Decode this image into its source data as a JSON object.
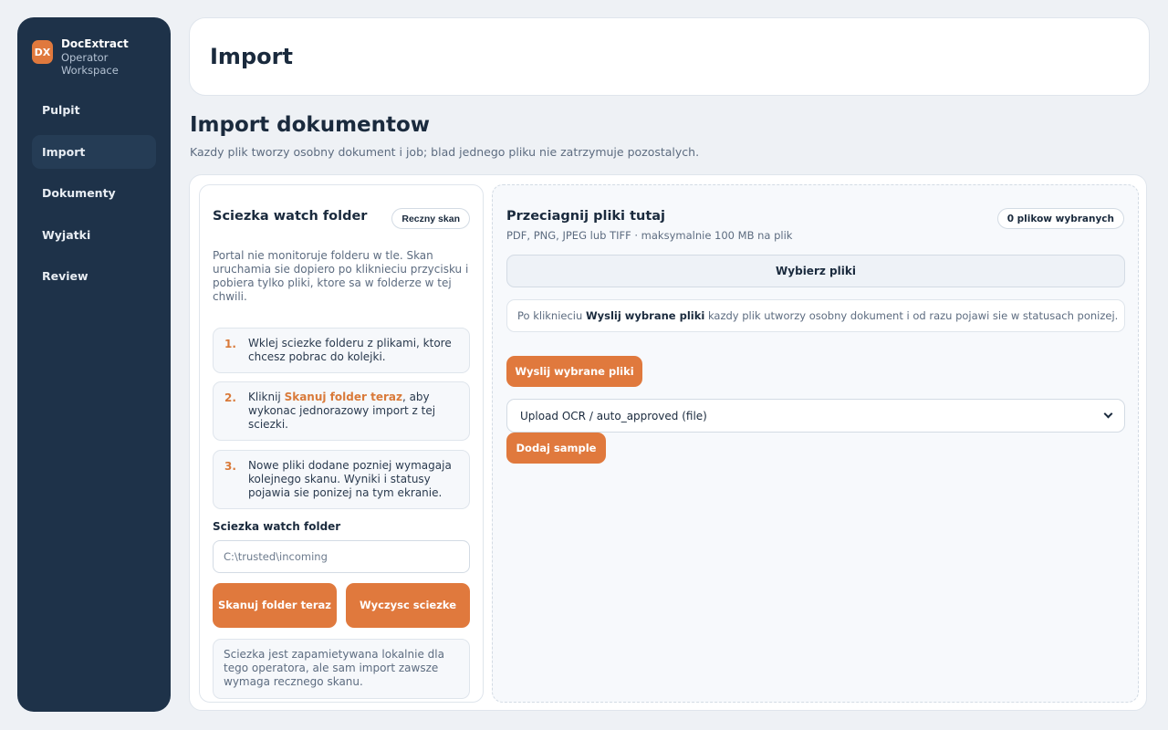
{
  "brand": {
    "logo": "DX",
    "name": "DocExtract",
    "subtitle": "Operator Workspace"
  },
  "sidebar": {
    "items": [
      {
        "label": "Pulpit",
        "active": false
      },
      {
        "label": "Import",
        "active": true
      },
      {
        "label": "Dokumenty",
        "active": false
      },
      {
        "label": "Wyjatki",
        "active": false
      },
      {
        "label": "Review",
        "active": false
      }
    ]
  },
  "header": {
    "title": "Import"
  },
  "page": {
    "title": "Import dokumentow",
    "subtitle": "Kazdy plik tworzy osobny dokument i job; blad jednego pliku nie zatrzymuje pozostalych."
  },
  "watch": {
    "title": "Sciezka watch folder",
    "manual_scan": "Reczny skan",
    "description": "Portal nie monitoruje folderu w tle. Skan uruchamia sie dopiero po kliknieciu przycisku i pobiera tylko pliki, ktore sa w folderze w tej chwili.",
    "steps": [
      {
        "num": "1.",
        "text": "Wklej sciezke folderu z plikami, ktore chcesz pobrac do kolejki."
      },
      {
        "num": "2.",
        "before": "Kliknij ",
        "highlight": "Skanuj folder teraz",
        "after": ", aby wykonac jednorazowy import z tej sciezki."
      },
      {
        "num": "3.",
        "text": "Nowe pliki dodane pozniej wymagaja kolejnego skanu. Wyniki i statusy pojawia sie ponizej na tym ekranie."
      }
    ],
    "field_label": "Sciezka watch folder",
    "input_value": "C:\\trusted\\incoming",
    "scan_button": "Skanuj folder teraz",
    "clear_button": "Wyczysc sciezke",
    "note": "Sciezka jest zapamietywana lokalnie dla tego operatora, ale sam import zawsze wymaga recznego skanu."
  },
  "upload": {
    "title": "Przeciagnij pliki tutaj",
    "subtitle": "PDF, PNG, JPEG lub TIFF · maksymalnie 100 MB na plik",
    "count": "0 plikow wybranych",
    "choose_button": "Wybierz pliki",
    "info_before": "Po kliknieciu ",
    "info_bold": "Wyslij wybrane pliki",
    "info_after": " kazdy plik utworzy osobny dokument i od razu pojawi sie w statusach ponizej.",
    "send_button": "Wyslij wybrane pliki",
    "select_value": "Upload OCR / auto_approved (file)",
    "sample_button": "Dodaj sample"
  },
  "colors": {
    "accent": "#e0793d",
    "sidebar_bg": "#1e3249",
    "page_bg": "#eef1f5"
  }
}
